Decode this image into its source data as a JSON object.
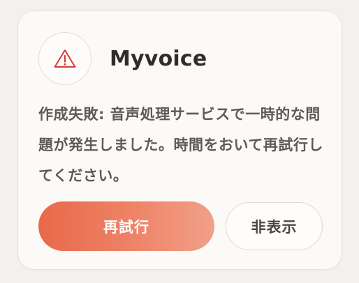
{
  "notification": {
    "app_name": "Myvoice",
    "message": "作成失敗: 音声処理サービスで一時的な問題が発生しました。時間をおいて再試行してください。",
    "icon": "warning-triangle-icon",
    "actions": {
      "retry_label": "再試行",
      "dismiss_label": "非表示"
    }
  },
  "colors": {
    "accent": "#e9694a",
    "warning_icon": "#d63b36",
    "card_background": "#fcfaf7",
    "page_background": "#f3f1ed"
  }
}
